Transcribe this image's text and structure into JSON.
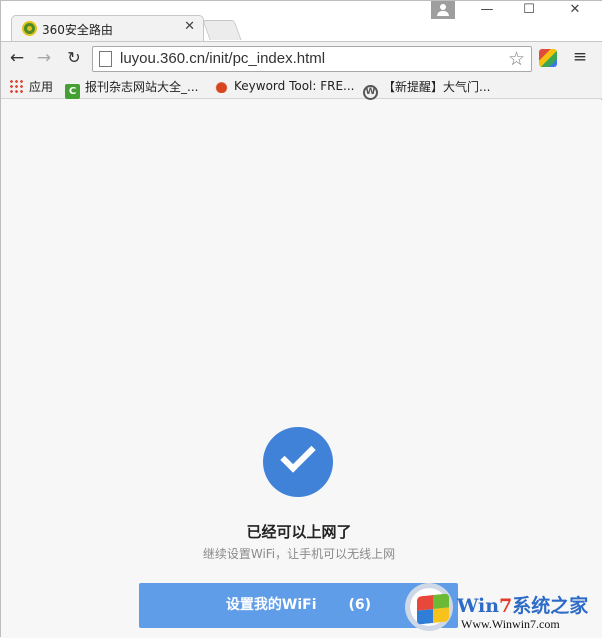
{
  "browser": {
    "tab_title": "360安全路由",
    "tab_close": "✕",
    "url": "luyou.360.cn/init/pc_index.html",
    "window_controls": {
      "minimize": "—",
      "maximize": "☐",
      "close": "✕"
    },
    "nav": {
      "back": "←",
      "forward": "→",
      "reload": "↻",
      "star": "☆",
      "menu": "≡"
    },
    "bookmarks": [
      {
        "label": "应用",
        "icon": "apps-icon"
      },
      {
        "label": "报刊杂志网站大全_...",
        "icon": "bookmark-icon-green"
      },
      {
        "label": "Keyword Tool: FRE...",
        "icon": "fire-icon"
      },
      {
        "label": "【新提醒】大气门...",
        "icon": "wordpress-icon"
      }
    ]
  },
  "page": {
    "title": "已经可以上网了",
    "subtitle": "继续设置WiFi，让手机可以无线上网",
    "button_label": "设置我的WiFi",
    "button_countdown": "(6)",
    "accent_color": "#3f82d8"
  },
  "watermark": {
    "brand_prefix": "Win",
    "brand_seven": "7",
    "brand_suffix": "系统之家",
    "url": "Www.Winwin7.com"
  }
}
